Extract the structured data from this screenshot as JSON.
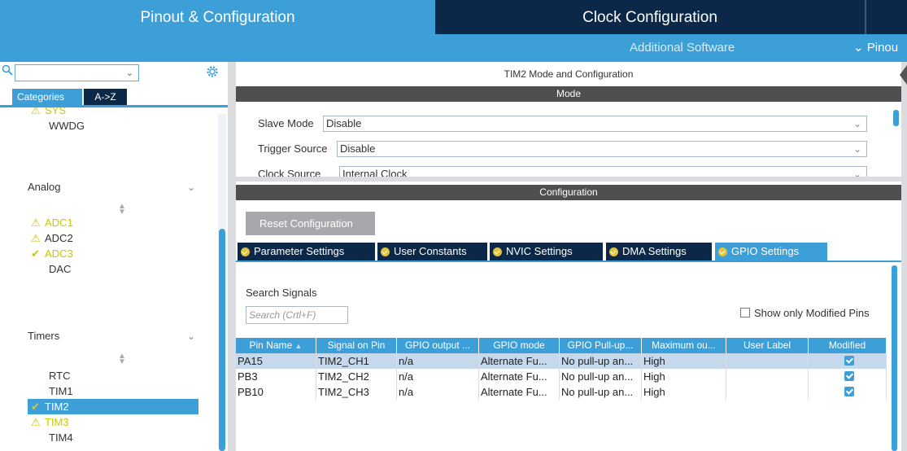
{
  "top_tabs": {
    "pinout": "Pinout & Configuration",
    "clock": "Clock Configuration"
  },
  "subbar": {
    "additional_software": "Additional Software",
    "pinout_menu": "Pinou"
  },
  "left": {
    "category_tabs": [
      "Categories",
      "A->Z"
    ],
    "tree": {
      "sys": "SYS",
      "wwdg": "WWDG",
      "analog_header": "Analog",
      "adc1": "ADC1",
      "adc2": "ADC2",
      "adc3": "ADC3",
      "dac": "DAC",
      "timers_header": "Timers",
      "rtc": "RTC",
      "tim1": "TIM1",
      "tim2": "TIM2",
      "tim3": "TIM3",
      "tim4": "TIM4"
    }
  },
  "right": {
    "title": "TIM2 Mode and Configuration",
    "mode_header": "Mode",
    "slave_mode": {
      "label": "Slave Mode",
      "value": "Disable"
    },
    "trigger_source": {
      "label": "Trigger Source",
      "value": "Disable"
    },
    "clock_source": {
      "label": "Clock Source",
      "value": "Internal Clock"
    },
    "configuration_header": "Configuration",
    "reset_button": "Reset Configuration",
    "tabs": [
      "Parameter Settings",
      "User Constants",
      "NVIC Settings",
      "DMA Settings",
      "GPIO Settings"
    ],
    "active_tab": "GPIO Settings",
    "search_signals_label": "Search Signals",
    "search_placeholder": "Search (Crtl+F)",
    "show_only_modified": "Show only Modified Pins",
    "table": {
      "columns": [
        "Pin Name",
        "Signal on Pin",
        "GPIO output ...",
        "GPIO mode",
        "GPIO Pull-up...",
        "Maximum ou...",
        "User Label",
        "Modified"
      ],
      "rows": [
        {
          "pin": "PA15",
          "signal": "TIM2_CH1",
          "output": "n/a",
          "mode": "Alternate Fu...",
          "pull": "No pull-up an...",
          "max": "High",
          "label": "",
          "modified": true
        },
        {
          "pin": "PB3",
          "signal": "TIM2_CH2",
          "output": "n/a",
          "mode": "Alternate Fu...",
          "pull": "No pull-up an...",
          "max": "High",
          "label": "",
          "modified": true
        },
        {
          "pin": "PB10",
          "signal": "TIM2_CH3",
          "output": "n/a",
          "mode": "Alternate Fu...",
          "pull": "No pull-up an...",
          "max": "High",
          "label": "",
          "modified": true
        }
      ]
    }
  },
  "colors": {
    "accent": "#3d9fd8",
    "dark_navy": "#0b2849",
    "warning": "#e2c33b",
    "selected_row": "#c6d9ec"
  },
  "icons": [
    "search-icon",
    "gear-icon",
    "chevron-down-icon",
    "warning-icon",
    "check-icon",
    "sort-arrows-icon",
    "collapse-arrow-icon"
  ]
}
